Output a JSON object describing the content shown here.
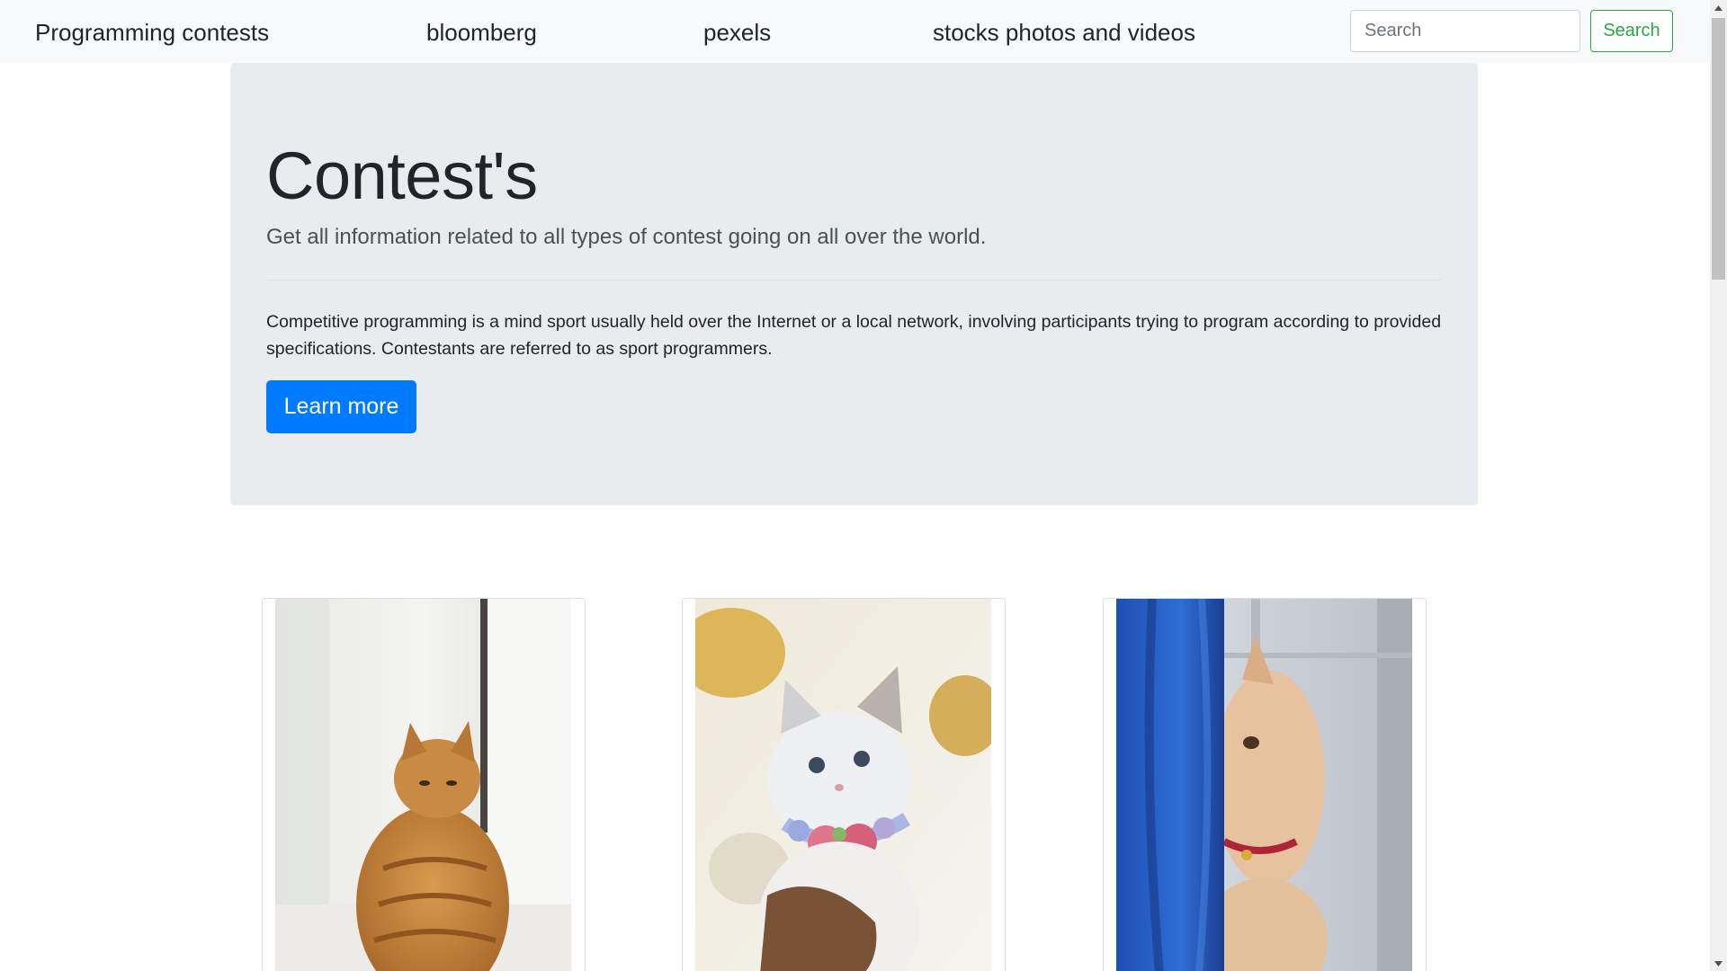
{
  "navbar": {
    "links": [
      {
        "label": "Programming contests"
      },
      {
        "label": "bloomberg"
      },
      {
        "label": "pexels"
      },
      {
        "label": "stocks photos and videos"
      }
    ],
    "search": {
      "placeholder": "Search",
      "value": ""
    },
    "search_button_label": "Search"
  },
  "jumbotron": {
    "title": "Contest's",
    "lead": "Get all information related to all types of contest going on all over the world.",
    "body": "Competitive programming is a mind sport usually held over the Internet or a local network, involving participants trying to program according to provided specifications. Contestants are referred to as sport programmers.",
    "button_label": "Learn more"
  },
  "cards": [
    {
      "image": "orange-tabby-cat-photo"
    },
    {
      "image": "white-kitten-flower-collar-photo"
    },
    {
      "image": "cream-cat-blue-curtain-photo"
    }
  ],
  "colors": {
    "navbar_bg": "#f8f9fa",
    "jumbotron_bg": "#e9ecef",
    "primary": "#007bff",
    "success": "#28a745"
  }
}
